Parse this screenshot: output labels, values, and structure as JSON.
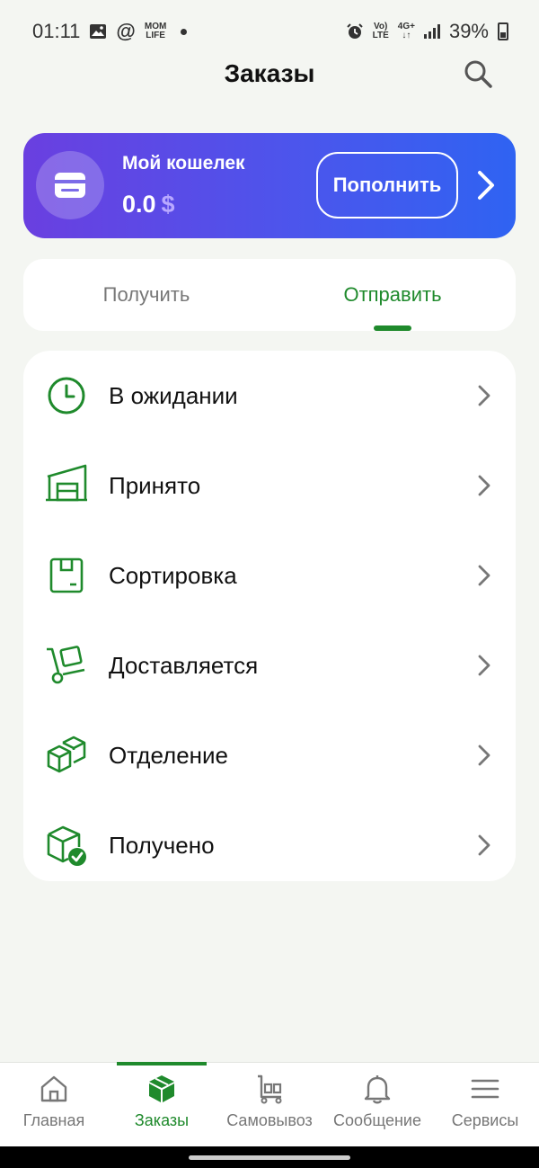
{
  "status_bar": {
    "time": "01:11",
    "left_icons": [
      "image-icon",
      "at-icon",
      "momlife-icon"
    ],
    "momlife_text": "MOM\nLIFE",
    "volte_text": "Vo)\nLTE",
    "net_text": "4G+\n↓↑",
    "battery": "39%"
  },
  "header": {
    "title": "Заказы",
    "search_icon": "search-icon"
  },
  "wallet": {
    "title": "Мой кошелек",
    "amount": "0.0",
    "currency": "$",
    "topup_label": "Пополнить"
  },
  "tabs": [
    {
      "label": "Получить",
      "active": false
    },
    {
      "label": "Отправить",
      "active": true
    }
  ],
  "statuses": [
    {
      "label": "В ожидании",
      "icon": "clock-icon"
    },
    {
      "label": "Принято",
      "icon": "warehouse-icon"
    },
    {
      "label": "Сортировка",
      "icon": "box-icon"
    },
    {
      "label": "Доставляется",
      "icon": "hand-truck-icon"
    },
    {
      "label": "Отделение",
      "icon": "boxes-icon"
    },
    {
      "label": "Получено",
      "icon": "box-check-icon"
    }
  ],
  "bottom_nav": [
    {
      "label": "Главная",
      "icon": "home-icon",
      "active": false
    },
    {
      "label": "Заказы",
      "icon": "package-icon",
      "active": true
    },
    {
      "label": "Самовывоз",
      "icon": "cart-icon",
      "active": false
    },
    {
      "label": "Сообщение",
      "icon": "bell-icon",
      "active": false
    },
    {
      "label": "Сервисы",
      "icon": "menu-icon",
      "active": false
    }
  ],
  "colors": {
    "accent_green": "#1f8a2c",
    "wallet_gradient_start": "#6a3fe0",
    "wallet_gradient_end": "#2f63f2",
    "background": "#f4f6f2"
  }
}
